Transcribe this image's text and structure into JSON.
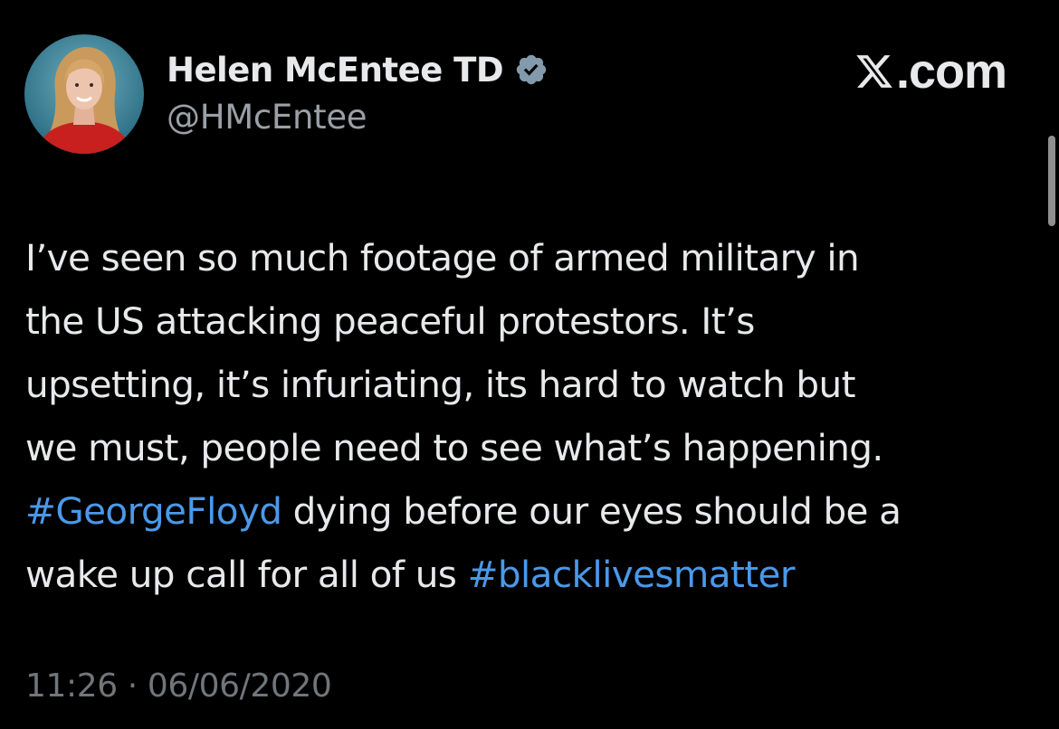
{
  "author": {
    "display_name": "Helen McEntee TD",
    "handle": "@HMcEntee",
    "verified_icon": "verified-badge-icon",
    "avatar": "profile-photo"
  },
  "site": {
    "logo_icon": "x-logo-icon",
    "suffix": ".com"
  },
  "tweet": {
    "line1": "I’ve seen so much footage of armed military in",
    "line2": "the US attacking peaceful protestors. It’s",
    "line3": "upsetting, it’s infuriating, its hard to watch but",
    "line4": "we must, people need to see what’s happening.",
    "hashtag1": "#GeorgeFloyd",
    "line5_rest": " dying before our eyes should be a",
    "line6_start": "wake up call for all of us ",
    "hashtag2": "#blacklivesmatter"
  },
  "meta": {
    "timestamp": "11:26 · 06/06/2020"
  },
  "colors": {
    "background": "#000000",
    "text": "#e7e9ea",
    "secondary": "#71767b",
    "hashtag": "#4a99e9",
    "verified_badge": "#829aab"
  }
}
